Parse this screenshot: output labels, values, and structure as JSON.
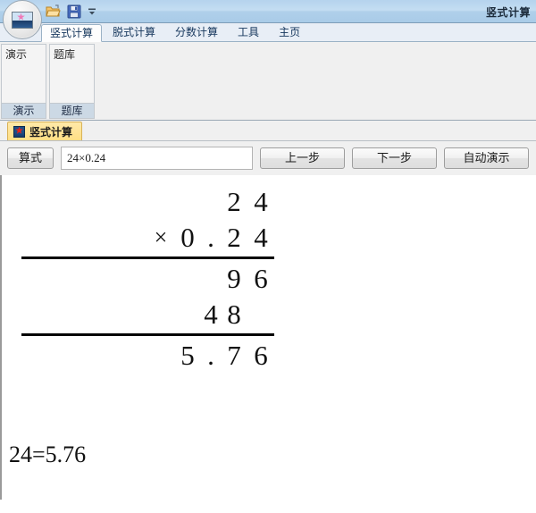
{
  "window": {
    "title": "竖式计算"
  },
  "quick_access": {
    "open_label": "open-file",
    "save_label": "save",
    "more_label": "more"
  },
  "office_button": {
    "label": "office-menu"
  },
  "ribbon": {
    "tabs": [
      {
        "label": "竖式计算",
        "active": true
      },
      {
        "label": "脱式计算",
        "active": false
      },
      {
        "label": "分数计算",
        "active": false
      },
      {
        "label": "工具",
        "active": false
      },
      {
        "label": "主页",
        "active": false
      }
    ],
    "groups": [
      {
        "button_label": "演示",
        "caption": "演示"
      },
      {
        "button_label": "题库",
        "caption": "题库"
      }
    ]
  },
  "document_tabs": [
    {
      "label": "竖式计算"
    }
  ],
  "toolbar": {
    "formula_button": "算式",
    "formula_value": "24×0.24",
    "formula_placeholder": "",
    "prev_step": "上一步",
    "next_step": "下一步",
    "auto_demo": "自动演示",
    "extra_button": ""
  },
  "calculation": {
    "rows": [
      {
        "type": "digits",
        "cells": [
          "",
          "",
          "",
          "2",
          "4"
        ]
      },
      {
        "type": "digits",
        "cells": [
          "×",
          "0",
          ".",
          "2",
          "4"
        ]
      },
      {
        "type": "rule"
      },
      {
        "type": "digits",
        "cells": [
          "",
          "",
          "",
          "9",
          "6"
        ]
      },
      {
        "type": "digits",
        "cells": [
          "",
          "",
          "4",
          "8",
          ""
        ]
      },
      {
        "type": "rule"
      },
      {
        "type": "digits",
        "cells": [
          "",
          "5",
          ".",
          "7",
          "6"
        ]
      }
    ],
    "result_text": "24=5.76"
  }
}
